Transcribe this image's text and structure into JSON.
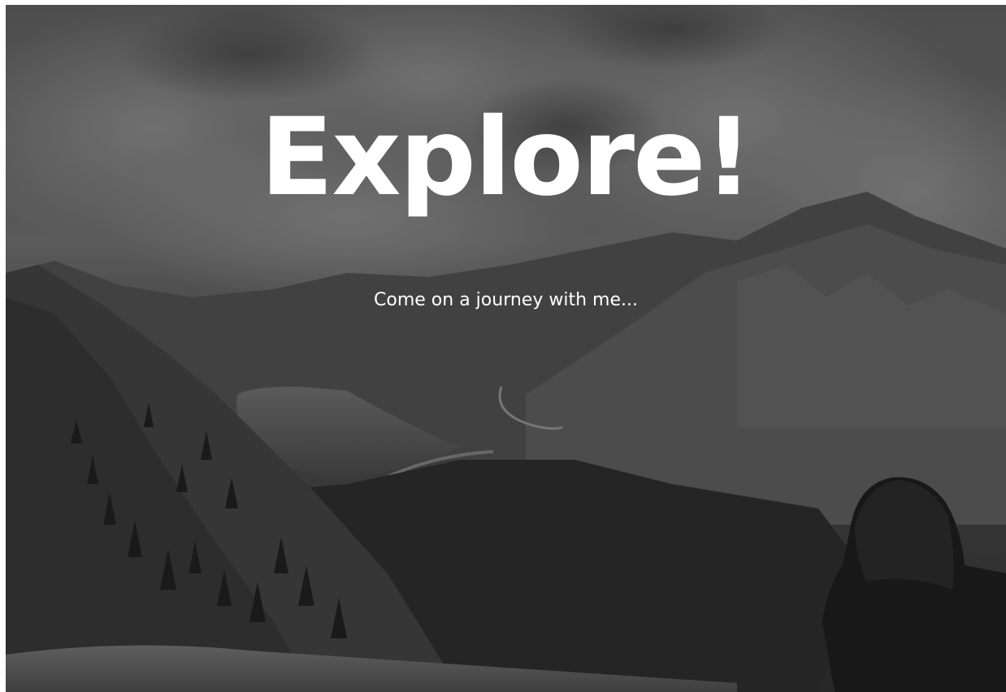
{
  "hero": {
    "title": "Explore!",
    "subtitle": "Come on a journey with me...",
    "background_image": "mountain-lake-landscape-with-hiker-photo"
  },
  "colors": {
    "text": "#ffffff",
    "background_tone": "#4a4a4a"
  }
}
